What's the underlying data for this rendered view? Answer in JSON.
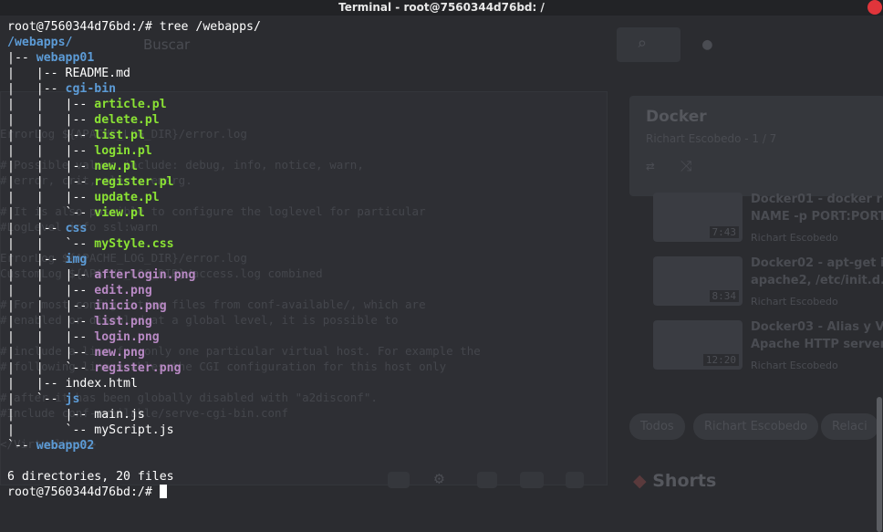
{
  "window": {
    "title": "Terminal - root@7560344d76bd: /"
  },
  "terminal": {
    "prompt": "root@7560344d76bd:/# ",
    "command": "tree /webapps/",
    "final_prompt": "root@7560344d76bd:/# ",
    "lines": [
      [
        {
          "t": "/webapps/",
          "c": "blue"
        }
      ],
      [
        {
          "t": "|-- ",
          "c": "white"
        },
        {
          "t": "webapp01",
          "c": "blue"
        }
      ],
      [
        {
          "t": "|   |-- README.md",
          "c": "white"
        }
      ],
      [
        {
          "t": "|   |-- ",
          "c": "white"
        },
        {
          "t": "cgi-bin",
          "c": "blue"
        }
      ],
      [
        {
          "t": "|   |   |-- ",
          "c": "white"
        },
        {
          "t": "article.pl",
          "c": "green"
        }
      ],
      [
        {
          "t": "|   |   |-- ",
          "c": "white"
        },
        {
          "t": "delete.pl",
          "c": "green"
        }
      ],
      [
        {
          "t": "|   |   |-- ",
          "c": "white"
        },
        {
          "t": "list.pl",
          "c": "green"
        }
      ],
      [
        {
          "t": "|   |   |-- ",
          "c": "white"
        },
        {
          "t": "login.pl",
          "c": "green"
        }
      ],
      [
        {
          "t": "|   |   |-- ",
          "c": "white"
        },
        {
          "t": "new.pl",
          "c": "green"
        }
      ],
      [
        {
          "t": "|   |   |-- ",
          "c": "white"
        },
        {
          "t": "register.pl",
          "c": "green"
        }
      ],
      [
        {
          "t": "|   |   |-- ",
          "c": "white"
        },
        {
          "t": "update.pl",
          "c": "green"
        }
      ],
      [
        {
          "t": "|   |   `-- ",
          "c": "white"
        },
        {
          "t": "view.pl",
          "c": "green"
        }
      ],
      [
        {
          "t": "|   |-- ",
          "c": "white"
        },
        {
          "t": "css",
          "c": "blue"
        }
      ],
      [
        {
          "t": "|   |   `-- ",
          "c": "white"
        },
        {
          "t": "myStyle.css",
          "c": "green"
        }
      ],
      [
        {
          "t": "|   |-- ",
          "c": "white"
        },
        {
          "t": "img",
          "c": "blue"
        }
      ],
      [
        {
          "t": "|   |   |-- ",
          "c": "white"
        },
        {
          "t": "afterlogin.png",
          "c": "magenta"
        }
      ],
      [
        {
          "t": "|   |   |-- ",
          "c": "white"
        },
        {
          "t": "edit.png",
          "c": "magenta"
        }
      ],
      [
        {
          "t": "|   |   |-- ",
          "c": "white"
        },
        {
          "t": "inicio.png",
          "c": "magenta"
        }
      ],
      [
        {
          "t": "|   |   |-- ",
          "c": "white"
        },
        {
          "t": "list.png",
          "c": "magenta"
        }
      ],
      [
        {
          "t": "|   |   |-- ",
          "c": "white"
        },
        {
          "t": "login.png",
          "c": "magenta"
        }
      ],
      [
        {
          "t": "|   |   |-- ",
          "c": "white"
        },
        {
          "t": "new.png",
          "c": "magenta"
        }
      ],
      [
        {
          "t": "|   |   `-- ",
          "c": "white"
        },
        {
          "t": "register.png",
          "c": "magenta"
        }
      ],
      [
        {
          "t": "|   |-- index.html",
          "c": "white"
        }
      ],
      [
        {
          "t": "|   `-- ",
          "c": "white"
        },
        {
          "t": "js",
          "c": "blue"
        }
      ],
      [
        {
          "t": "|       |-- main.js",
          "c": "white"
        }
      ],
      [
        {
          "t": "|       `-- myScript.js",
          "c": "white"
        }
      ],
      [
        {
          "t": "`-- ",
          "c": "white"
        },
        {
          "t": "webapp02",
          "c": "blue"
        }
      ],
      [
        {
          "t": "",
          "c": "white"
        }
      ],
      [
        {
          "t": "6 directories, 20 files",
          "c": "white"
        }
      ]
    ]
  },
  "colors": {
    "directory": "#5c9bd6",
    "executable": "#8ae234",
    "image": "#b889c4",
    "text": "#ffffff",
    "close_button": "#e0353b"
  },
  "background_window": {
    "search_placeholder": "Buscar",
    "playlist_title": "Docker",
    "playlist_subtitle": "Richart Escobedo - 1 / 7",
    "videos": [
      {
        "title_line1": "Docker01 - docker run",
        "title_line2": "NAME -p PORT:PORT",
        "channel": "Richart Escobedo",
        "duration": "7:43"
      },
      {
        "title_line1": "Docker02 - apt-get in",
        "title_line2": "apache2, /etc/init.d...",
        "channel": "Richart Escobedo",
        "duration": "8:34"
      },
      {
        "title_line1": "Docker03 - Alias y V",
        "title_line2": "Apache HTTP server",
        "channel": "Richart Escobedo",
        "duration": "12:20"
      }
    ],
    "chips": [
      "Todos",
      "Richart Escobedo",
      "Relaci"
    ],
    "shorts_label": "Shorts",
    "bleed_text": [
      "ErrorLog ${APACHE_LOG_DIR}/error.log",
      "# Possible values include: debug, info, notice, warn,",
      "# error, crit, alert, emerg.",
      "# It is also possible to configure the loglevel for particular",
      "#LogLevel info ssl:warn",
      "ErrorLog ${APACHE_LOG_DIR}/error.log",
      "CustomLog ${APACHE_LOG_DIR}/access.log combined",
      "# For most configuration files from conf-available/, which are",
      "# enabled or disabled at a global level, it is possible to",
      "# include a line for only one particular virtual host. For example the",
      "# following line enables the CGI configuration for this host only",
      "# after it has been globally disabled with \"a2disconf\".",
      "#Include conf-available/serve-cgi-bin.conf",
      "</VirtualHost>"
    ]
  }
}
